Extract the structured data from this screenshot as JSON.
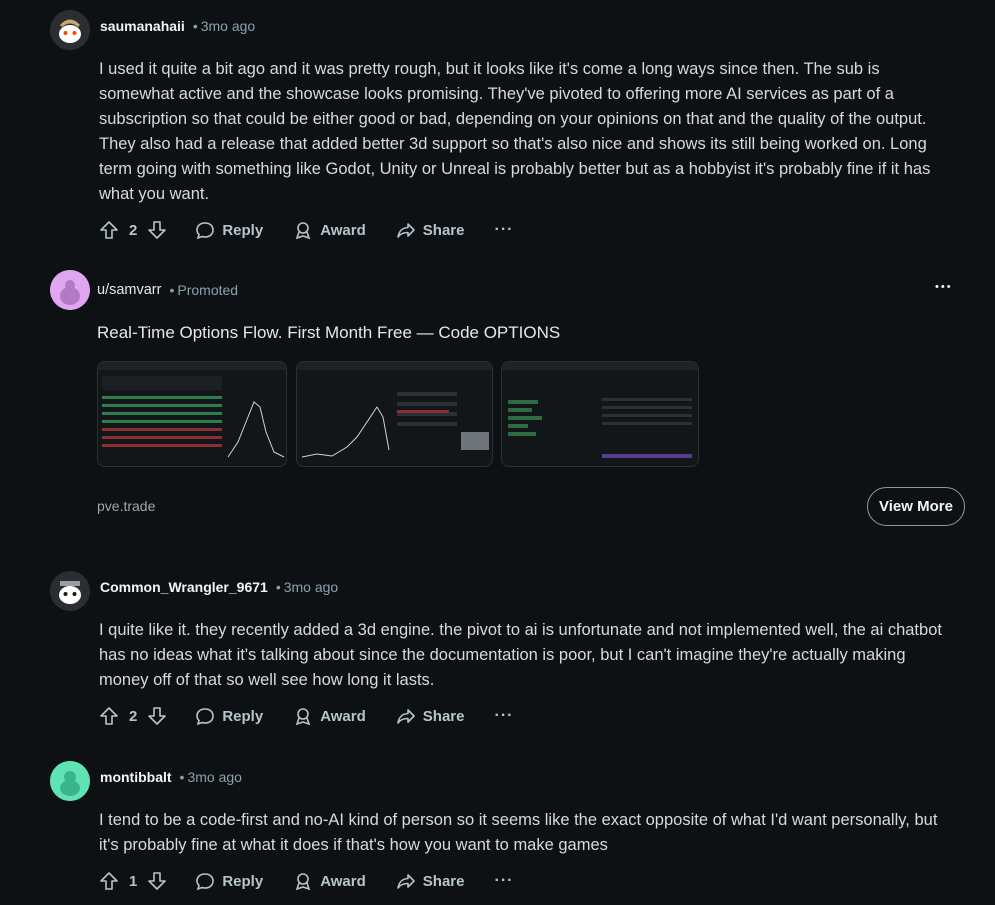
{
  "comments": [
    {
      "username": "saumanahaii",
      "time": "3mo ago",
      "body": "I used it quite a bit ago and it was pretty rough, but it looks like it's come a long ways since then. The sub is somewhat active and the showcase looks promising. They've pivoted to offering more AI services as part of a subscription so that could be either good or bad, depending on your opinions on that and the quality of the output. They also had a release that added better 3d support so that's also nice and shows its still being worked on. Long term going with something like Godot, Unity or Unreal is probably better but as a hobbyist it's probably fine if it has what you want.",
      "votes": "2",
      "avatar_color": "#3a3f44"
    },
    {
      "username": "Common_Wrangler_9671",
      "time": "3mo ago",
      "body": "I quite like it. they recently added a 3d engine. the pivot to ai is unfortunate and not implemented well, the ai chatbot has no ideas what it's talking about since the documentation is poor, but I can't imagine they're actually making money off of that so well see how long it lasts.",
      "votes": "2",
      "avatar_color": "#2b2f33"
    },
    {
      "username": "montibbalt",
      "time": "3mo ago",
      "body": "I tend to be a code-first and no-AI kind of person so it seems like the exact opposite of what I'd want personally, but it's probably fine at what it does if that's how you want to make games",
      "votes": "1",
      "avatar_color": "#5fe3b4"
    }
  ],
  "actions": {
    "reply": "Reply",
    "award": "Award",
    "share": "Share",
    "more": "···"
  },
  "promoted": {
    "username": "u/samvarr",
    "label": "Promoted",
    "headline": "Real-Time Options Flow. First Month Free — Code OPTIONS",
    "domain": "pve.trade",
    "cta": "View More",
    "more": "•••",
    "avatar_color": "#e1a6f2"
  },
  "separator": "•"
}
